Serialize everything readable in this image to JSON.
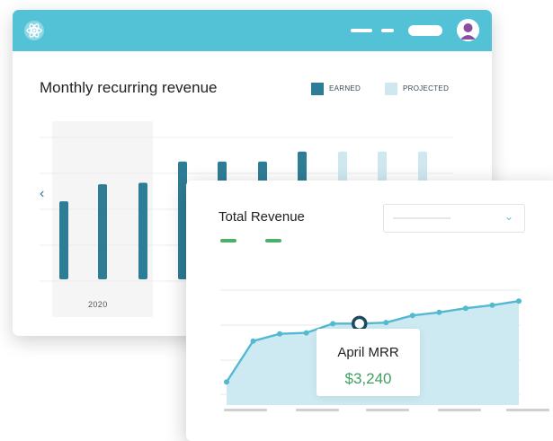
{
  "colors": {
    "header": "#53c2d6",
    "earned": "#2e7d96",
    "projected": "#cfe8f0",
    "line": "#53b9d1",
    "area": "#cdeaf2",
    "money": "#3fa063"
  },
  "icons": {
    "logo": "atom-logo-icon",
    "avatar": "user-avatar-icon",
    "nav_left": "chevron-left-icon",
    "dropdown": "chevron-down-icon"
  },
  "mrr_chart": {
    "title": "Monthly recurring revenue",
    "legend": [
      {
        "label": "EARNED",
        "color": "#2e7d96"
      },
      {
        "label": "PROJECTED",
        "color": "#cfe8f0"
      }
    ],
    "year_label": "2020",
    "chart_data": {
      "type": "bar",
      "series": [
        {
          "name": "EARNED",
          "values": [
            55,
            67,
            68,
            83,
            83,
            83,
            90
          ]
        },
        {
          "name": "PROJECTED",
          "values": [
            90,
            90,
            90
          ]
        }
      ],
      "ylim": [
        0,
        100
      ]
    }
  },
  "revenue_card": {
    "title": "Total Revenue",
    "tooltip_label": "April MRR",
    "tooltip_value": "$3,240",
    "chart_data": {
      "type": "area",
      "values": [
        5,
        45,
        52,
        53,
        62,
        62,
        63,
        70,
        73,
        77,
        80,
        84
      ],
      "highlight_index": 5
    }
  }
}
